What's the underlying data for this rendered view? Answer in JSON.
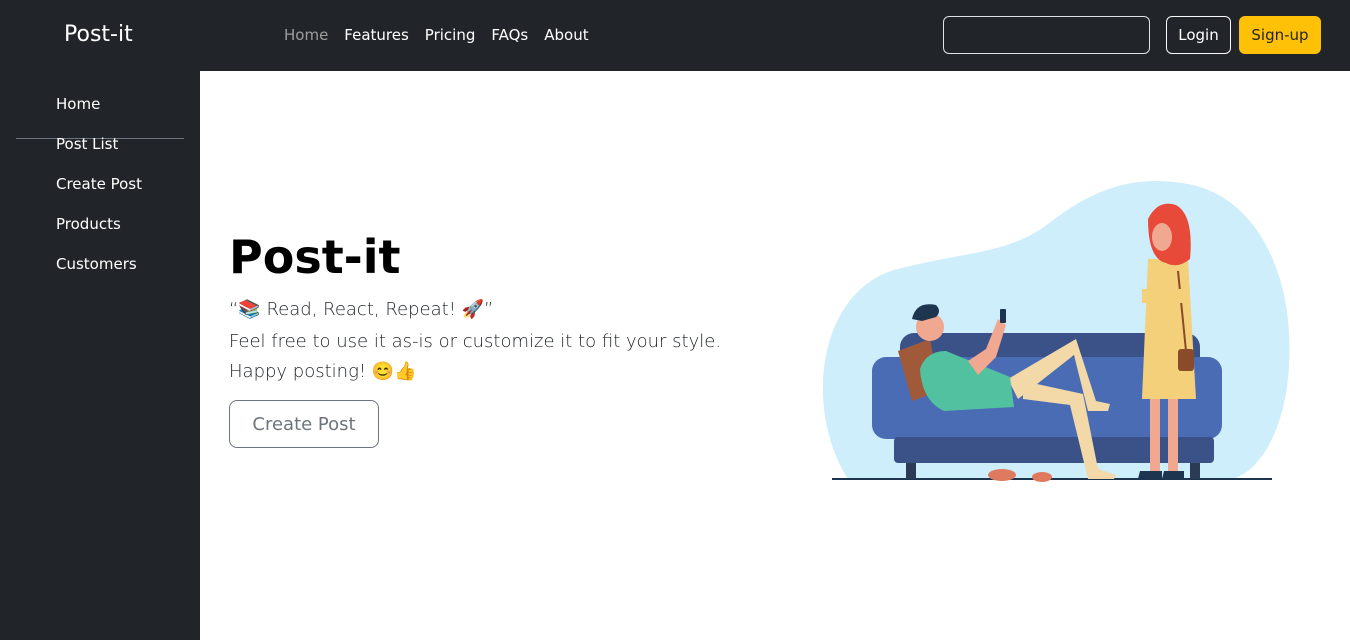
{
  "navbar": {
    "brand": "Post-it",
    "links": [
      {
        "label": "Home",
        "active": true
      },
      {
        "label": "Features"
      },
      {
        "label": "Pricing"
      },
      {
        "label": "FAQs"
      },
      {
        "label": "About"
      }
    ],
    "search": {
      "value": "",
      "placeholder": ""
    },
    "login_label": "Login",
    "signup_label": "Sign-up"
  },
  "sidebar": {
    "items": [
      {
        "label": "Home"
      },
      {
        "label": "Post List"
      },
      {
        "label": "Create Post"
      },
      {
        "label": "Products"
      },
      {
        "label": "Customers"
      }
    ]
  },
  "hero": {
    "title": "Post-it",
    "tagline": "“📚 Read, React, Repeat! 🚀”",
    "lead": "Feel free to use it as-is or customize it to fit your style. Happy posting! 😊👍",
    "button_label": "Create Post",
    "illustration_icon": "couch-people-illustration"
  },
  "colors": {
    "dark": "#212529",
    "accent": "#ffc107",
    "muted": "#6c757d"
  }
}
